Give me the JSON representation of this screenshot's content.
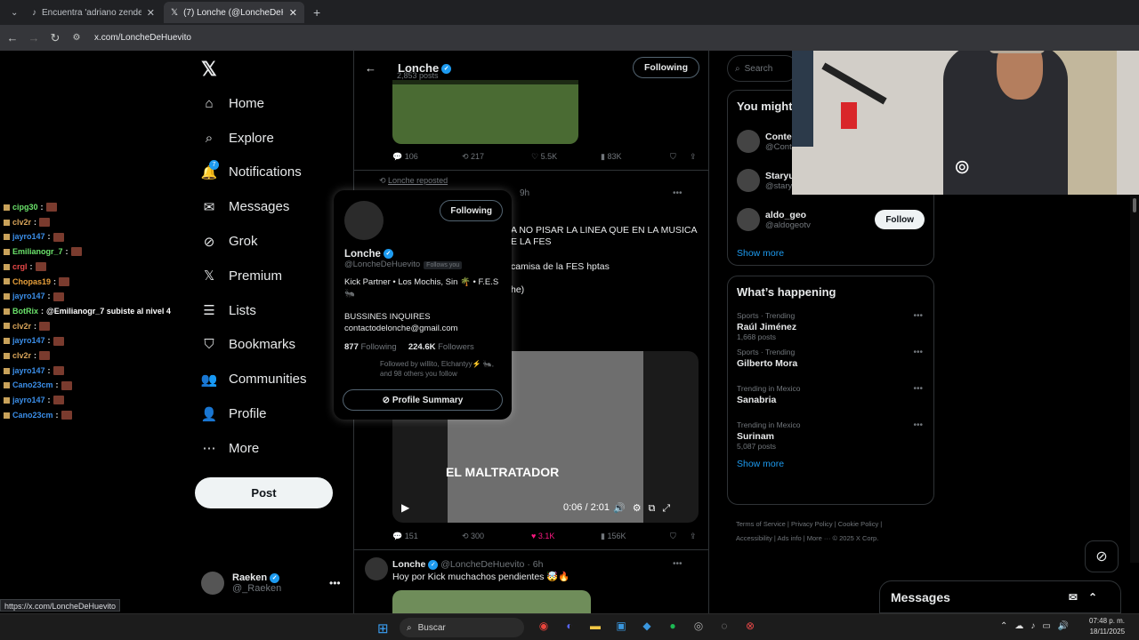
{
  "browser": {
    "tabs": [
      {
        "title": "Encuentra 'adriano zendejas lo"
      },
      {
        "title": "(7) Lonche (@LoncheDeHuevito"
      }
    ],
    "url": "x.com/LoncheDeHuevito",
    "status_url": "https://x.com/LoncheDeHuevito"
  },
  "chat": [
    {
      "user": "cipg30",
      "color": "#6be36b",
      "text": ""
    },
    {
      "user": "clv2r",
      "color": "#d9a55a",
      "text": ""
    },
    {
      "user": "jayro147",
      "color": "#3b8ee8",
      "text": ""
    },
    {
      "user": "Emilianogr_7",
      "color": "#6be36b",
      "text": ""
    },
    {
      "user": "crgl",
      "color": "#e84848",
      "text": ""
    },
    {
      "user": "Chopas19",
      "color": "#e8a03b",
      "text": ""
    },
    {
      "user": "jayro147",
      "color": "#3b8ee8",
      "text": ""
    },
    {
      "user": "BotRix",
      "color": "#6be36b",
      "text": "@Emilianogr_7 subiste al nivel 4"
    },
    {
      "user": "clv2r",
      "color": "#d9a55a",
      "text": ""
    },
    {
      "user": "jayro147",
      "color": "#3b8ee8",
      "text": ""
    },
    {
      "user": "clv2r",
      "color": "#d9a55a",
      "text": ""
    },
    {
      "user": "jayro147",
      "color": "#3b8ee8",
      "text": ""
    },
    {
      "user": "Cano23cm",
      "color": "#3b8ee8",
      "text": ""
    },
    {
      "user": "jayro147",
      "color": "#3b8ee8",
      "text": ""
    },
    {
      "user": "Cano23cm",
      "color": "#3b8ee8",
      "text": ""
    }
  ],
  "nav": {
    "items": [
      "Home",
      "Explore",
      "Notifications",
      "Messages",
      "Grok",
      "Premium",
      "Lists",
      "Bookmarks",
      "Communities",
      "Profile",
      "More"
    ],
    "notification_count": "7",
    "post_label": "Post",
    "account_name": "Raeken",
    "account_handle": "@_Raeken"
  },
  "profile": {
    "name": "Lonche",
    "posts": "2,853 posts",
    "following_label": "Following"
  },
  "tweet1": {
    "replies": "106",
    "reposts": "217",
    "likes": "5.5K",
    "views": "83K"
  },
  "tweet2": {
    "repost_label": "Lonche reposted",
    "time": "9h",
    "text1": "A NO PISAR LA LINEA QUE EN LA MUSICA",
    "text2": "E LA FES",
    "text3": "camisa de la FES hptas",
    "text4": "he)",
    "video_title": "EL MALTRATADOR",
    "video_time": "0:06 / 2:01",
    "replies": "151",
    "reposts": "300",
    "likes": "3.1K",
    "views": "156K"
  },
  "tweet3": {
    "name": "Lonche",
    "handle": "@LoncheDeHuevito",
    "time": "6h",
    "text": "Hoy por Kick muchachos pendientes 🤯🔥"
  },
  "hovercard": {
    "following_label": "Following",
    "name": "Lonche",
    "handle": "@LoncheDeHuevito",
    "follows_you": "Follows you",
    "bio1": "Kick Partner • Los Mochis, Sin 🌴 • F.E.S🐜",
    "bio2": "BUSSINES INQUIRES",
    "bio3": "contactodelonche@gmail.com",
    "following_count": "877",
    "following_word": "Following",
    "followers_count": "224.6K",
    "followers_word": "Followers",
    "followed_by": "Followed by willito, Elchantyy⚡ 🐜, and 98 others you follow",
    "summary_label": "Profile Summary"
  },
  "right": {
    "search_placeholder": "Search",
    "wtf_title": "You might",
    "wtf": [
      {
        "name": "Conte",
        "handle": "@Cont",
        "button": ""
      },
      {
        "name": "Staryu",
        "handle": "@stary",
        "button": ""
      },
      {
        "name": "aldo_geo",
        "handle": "@aldogeotv",
        "button": "Follow"
      }
    ],
    "show_more": "Show more",
    "happening_title": "What’s happening",
    "trends": [
      {
        "meta": "Sports · Trending",
        "title": "Raúl Jiménez",
        "count": "1,668 posts"
      },
      {
        "meta": "Sports · Trending",
        "title": "Gilberto Mora",
        "count": ""
      },
      {
        "meta": "Trending in Mexico",
        "title": "Sanabria",
        "count": ""
      },
      {
        "meta": "Trending in Mexico",
        "title": "Surinam",
        "count": "5,087 posts"
      }
    ],
    "footer1": "Terms of Service  |  Privacy Policy  |  Cookie Policy  |",
    "footer2": "Accessibility  |  Ads info  |  More ···  © 2025 X Corp."
  },
  "dock": {
    "messages": "Messages"
  },
  "taskbar": {
    "search": "Buscar",
    "time": "07:48 p. m.",
    "date": "18/11/2025"
  },
  "colors": {
    "accent": "#1d9bf0",
    "like": "#f91880",
    "bg": "#000000"
  }
}
